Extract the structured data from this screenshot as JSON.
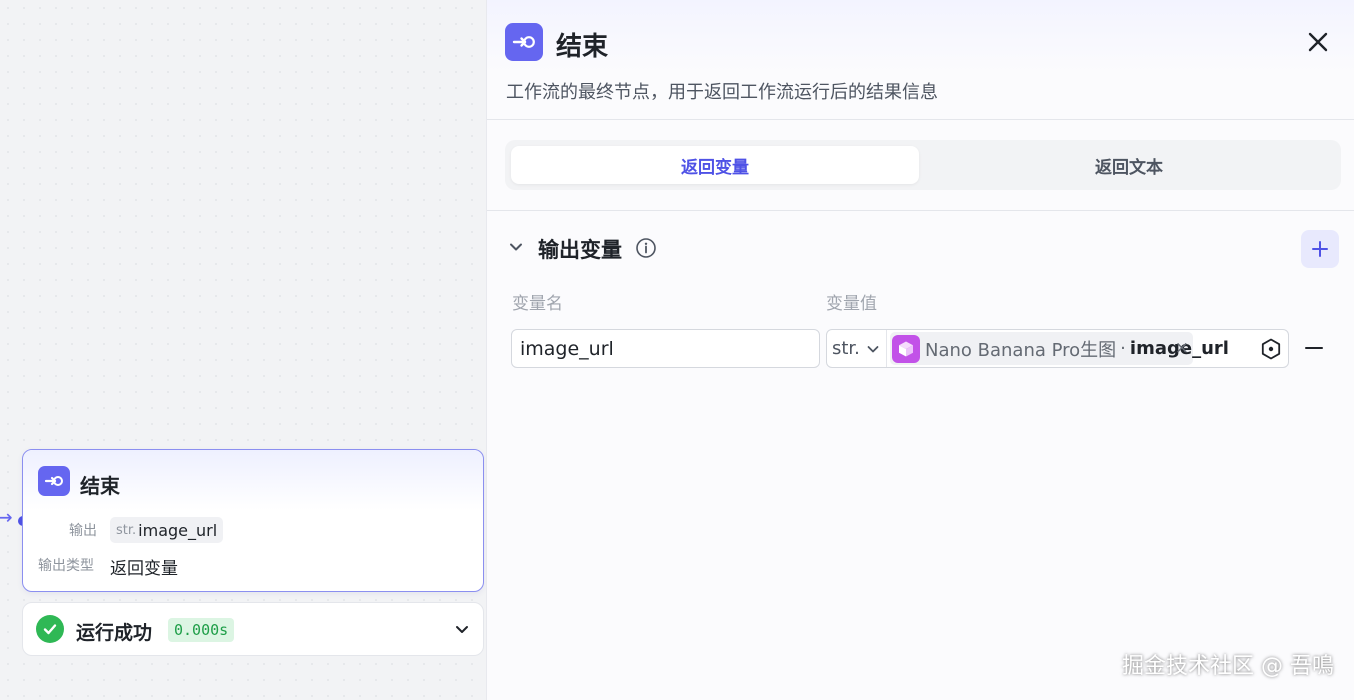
{
  "node": {
    "title": "结束",
    "output_label": "输出",
    "output_type": "str.",
    "output_name": "image_url",
    "type_label": "输出类型",
    "type_value": "返回变量"
  },
  "run": {
    "status": "运行成功",
    "duration": "0.000s"
  },
  "panel": {
    "title": "结束",
    "description": "工作流的最终节点，用于返回工作流运行后的结果信息",
    "tabs": [
      {
        "label": "返回变量",
        "active": true
      },
      {
        "label": "返回文本",
        "active": false
      }
    ],
    "section_title": "输出变量",
    "columns": {
      "name": "变量名",
      "value": "变量值"
    },
    "row": {
      "name": "image_url",
      "type": "str.",
      "source_node": "Nano Banana Pro生图",
      "separator": "·",
      "source_var": "image_url"
    }
  },
  "watermark": "掘金技术社区 @ 吾鳴",
  "colors": {
    "accent": "#6566f0",
    "success": "#2fb855",
    "cube": "#c252e8"
  }
}
